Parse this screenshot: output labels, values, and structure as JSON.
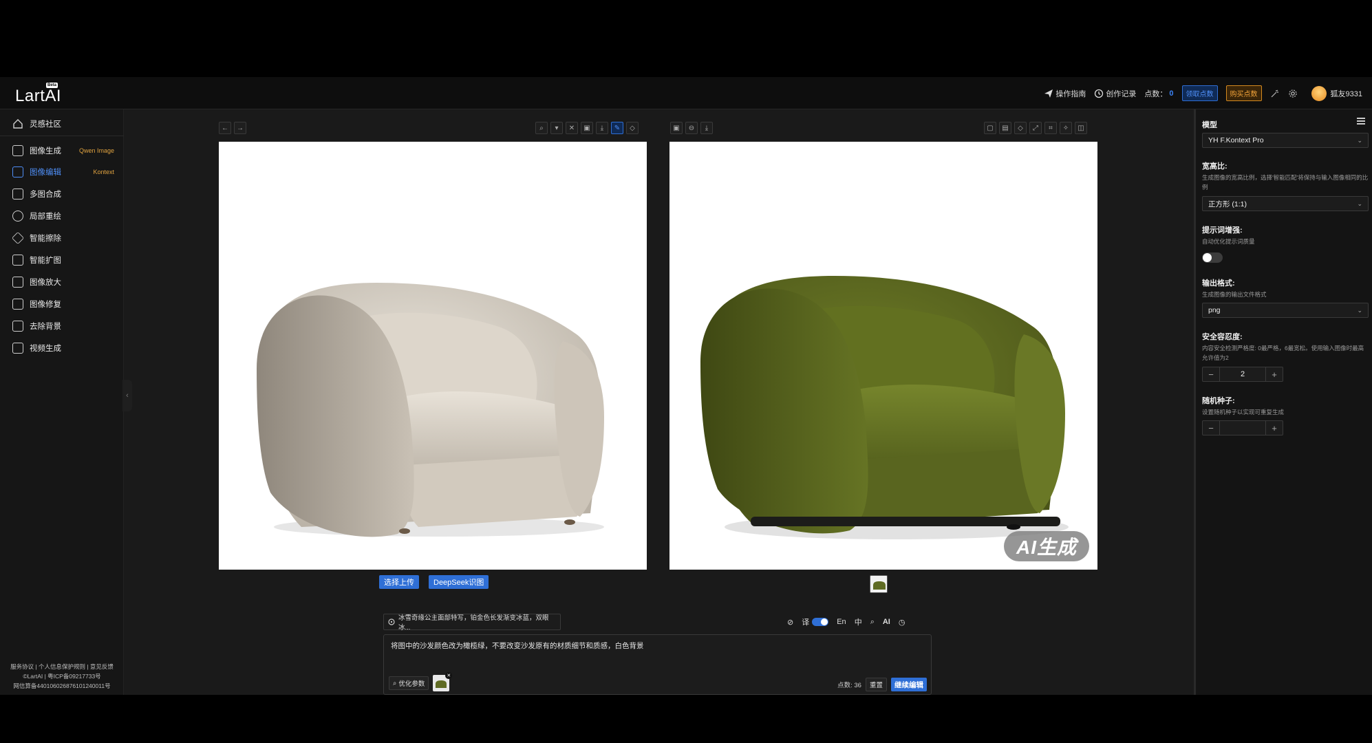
{
  "brand": {
    "name": "LartAI",
    "badge": "Beta"
  },
  "topbar": {
    "guide": "操作指南",
    "history": "创作记录",
    "points_label": "点数：",
    "points_value": "0",
    "claim_points": "领取点数",
    "buy_points": "购买点数",
    "username": "狐友9331"
  },
  "sidebar": {
    "community": "灵感社区",
    "items": [
      {
        "label": "图像生成",
        "tag": "Qwen Image"
      },
      {
        "label": "图像编辑",
        "tag": "Kontext"
      },
      {
        "label": "多图合成",
        "tag": ""
      },
      {
        "label": "局部重绘",
        "tag": ""
      },
      {
        "label": "智能擦除",
        "tag": ""
      },
      {
        "label": "智能扩图",
        "tag": ""
      },
      {
        "label": "图像放大",
        "tag": ""
      },
      {
        "label": "图像修复",
        "tag": ""
      },
      {
        "label": "去除背景",
        "tag": ""
      },
      {
        "label": "视频生成",
        "tag": ""
      }
    ],
    "footer": {
      "line1": "服务协议 | 个人信息保护规则 | 意见反馈",
      "line2": "©LartAI | 粤ICP备09217733号",
      "line3": "网信算备440106026876101240011号"
    }
  },
  "canvas": {
    "upload_button": "选择上传",
    "deepseek_button": "DeepSeek识图",
    "ai_badge": "AI生成"
  },
  "prompt": {
    "preset_chip": "冰雪奇缘公主面部特写，铂金色长发渐变冰蓝，双眼冰...",
    "translate_label": "译",
    "lang_en": "En",
    "lang_zh": "中",
    "ai_label": "AI",
    "text": "将图中的沙发颜色改为橄榄绿，不要改变沙发原有的材质细节和质感，白色背景",
    "optimize_button": "优化参数",
    "cost": "点数: 36",
    "reset_button": "重置",
    "continue_button": "继续编辑"
  },
  "settings": {
    "model_title": "模型",
    "model_value": "YH F.Kontext Pro",
    "ratio_title": "宽高比:",
    "ratio_desc": "生成图像的宽高比例，选择'智能匹配'将保持与输入图像相同的比例",
    "ratio_value": "正方形 (1:1)",
    "enhance_title": "提示词增强:",
    "enhance_desc": "自动优化提示词质量",
    "format_title": "输出格式:",
    "format_desc": "生成图像的输出文件格式",
    "format_value": "png",
    "safety_title": "安全容忍度:",
    "safety_desc": "内容安全检测严格度: 0最严格，6最宽松。使用输入图像时最高允许值为2",
    "safety_value": "2",
    "seed_title": "随机种子:",
    "seed_desc": "设置随机种子以实现可重复生成",
    "seed_value": ""
  },
  "colors": {
    "accent": "#2f6fd6",
    "orange": "#e0a340",
    "original_sofa": "#d9d2c6",
    "edited_sofa": "#5f6b23"
  }
}
